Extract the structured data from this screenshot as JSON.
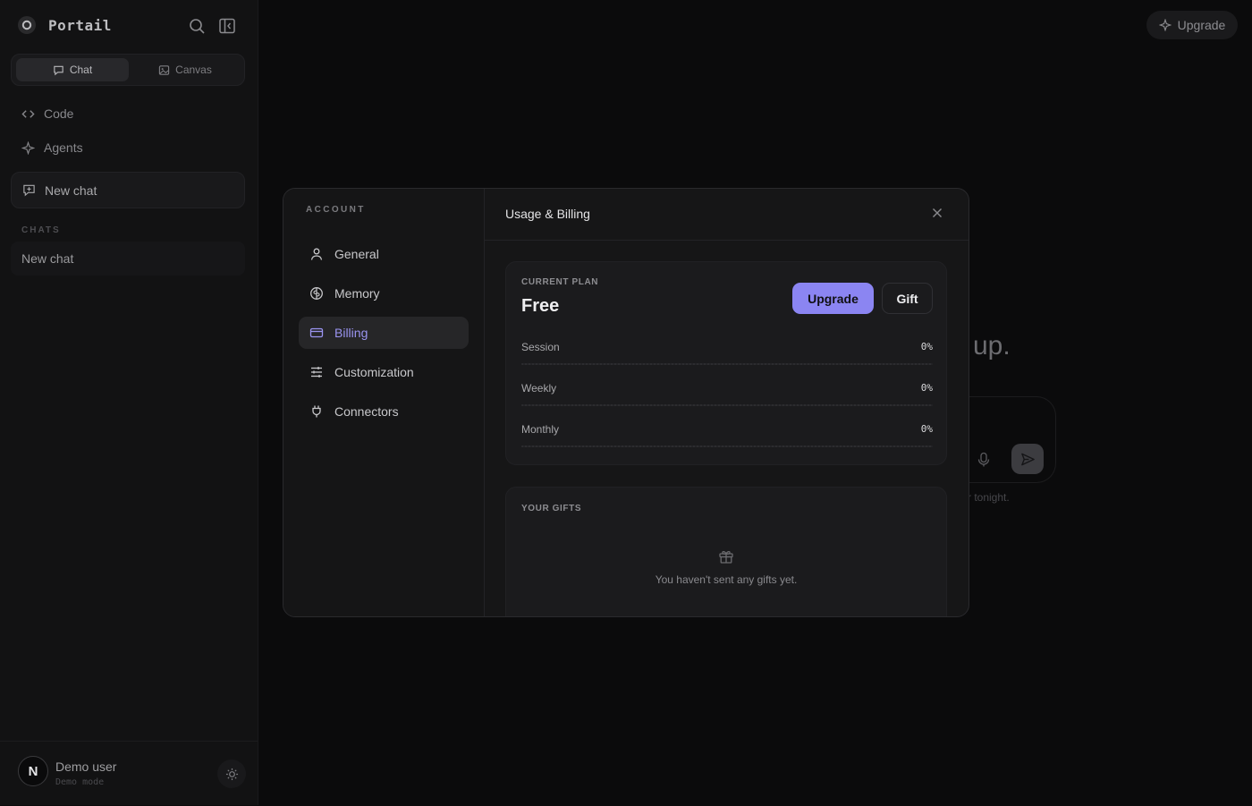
{
  "sidebar": {
    "brand_name": "Portail",
    "mode_tabs": [
      {
        "label": "Chat",
        "active": true
      },
      {
        "label": "Canvas",
        "active": false
      }
    ],
    "nav": [
      {
        "label": "Code",
        "icon": "code-icon"
      },
      {
        "label": "Agents",
        "icon": "sparkle-icon"
      }
    ],
    "new_chat_label": "New chat",
    "chats_section_label": "CHATS",
    "chats": [
      "New chat"
    ],
    "user": {
      "initial": "N",
      "name": "Demo user",
      "subtitle": "Demo mode"
    }
  },
  "main": {
    "upgrade_label": "Upgrade",
    "hero_partial": "up.",
    "hint_partial": "r tonight."
  },
  "modal": {
    "nav_heading": "ACCOUNT",
    "nav_items": [
      {
        "label": "General",
        "icon": "user-icon",
        "active": false
      },
      {
        "label": "Memory",
        "icon": "brain-icon",
        "active": false
      },
      {
        "label": "Billing",
        "icon": "credit-card-icon",
        "active": true
      },
      {
        "label": "Customization",
        "icon": "sliders-icon",
        "active": false
      },
      {
        "label": "Connectors",
        "icon": "plug-icon",
        "active": false
      }
    ],
    "title": "Usage & Billing",
    "plan": {
      "label": "CURRENT PLAN",
      "name": "Free",
      "upgrade_label": "Upgrade",
      "gift_label": "Gift"
    },
    "usage": [
      {
        "label": "Session",
        "value": "0%",
        "percent": 0
      },
      {
        "label": "Weekly",
        "value": "0%",
        "percent": 0
      },
      {
        "label": "Monthly",
        "value": "0%",
        "percent": 0
      }
    ],
    "gifts": {
      "label": "YOUR GIFTS",
      "empty_text": "You haven't sent any gifts yet."
    }
  },
  "colors": {
    "accent": "#8b85f2",
    "background": "#0b0b0c",
    "modal_background": "#161617"
  }
}
